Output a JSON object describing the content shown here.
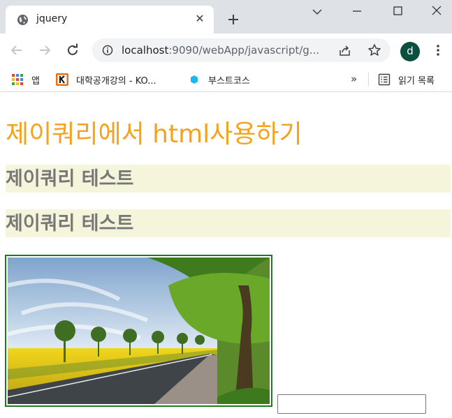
{
  "tab": {
    "title": "jquery",
    "close_glyph": "✕",
    "favicon": "globe-icon"
  },
  "toolbar": {
    "url_host": "localhost",
    "url_rest": ":9090/webApp/javascript/g...",
    "profile_initial": "d"
  },
  "bookmarks": {
    "apps_label": "앱",
    "kocw_label": "대학공개강의 - KO...",
    "boost_label": "부스트코스",
    "more_glyph": "»",
    "reading_label": "읽기 목록"
  },
  "page": {
    "heading": "제이쿼리에서 html사용하기",
    "sub1": "제이쿼리 테스트",
    "sub2": "제이쿼리 테스트",
    "input_value": ""
  },
  "colors": {
    "heading": "#f5a21d",
    "subheading_bg": "#f5f5dc",
    "subheading_text": "#777777",
    "image_border": "#1e7a1e",
    "profile_bg": "#0b4f3f"
  }
}
